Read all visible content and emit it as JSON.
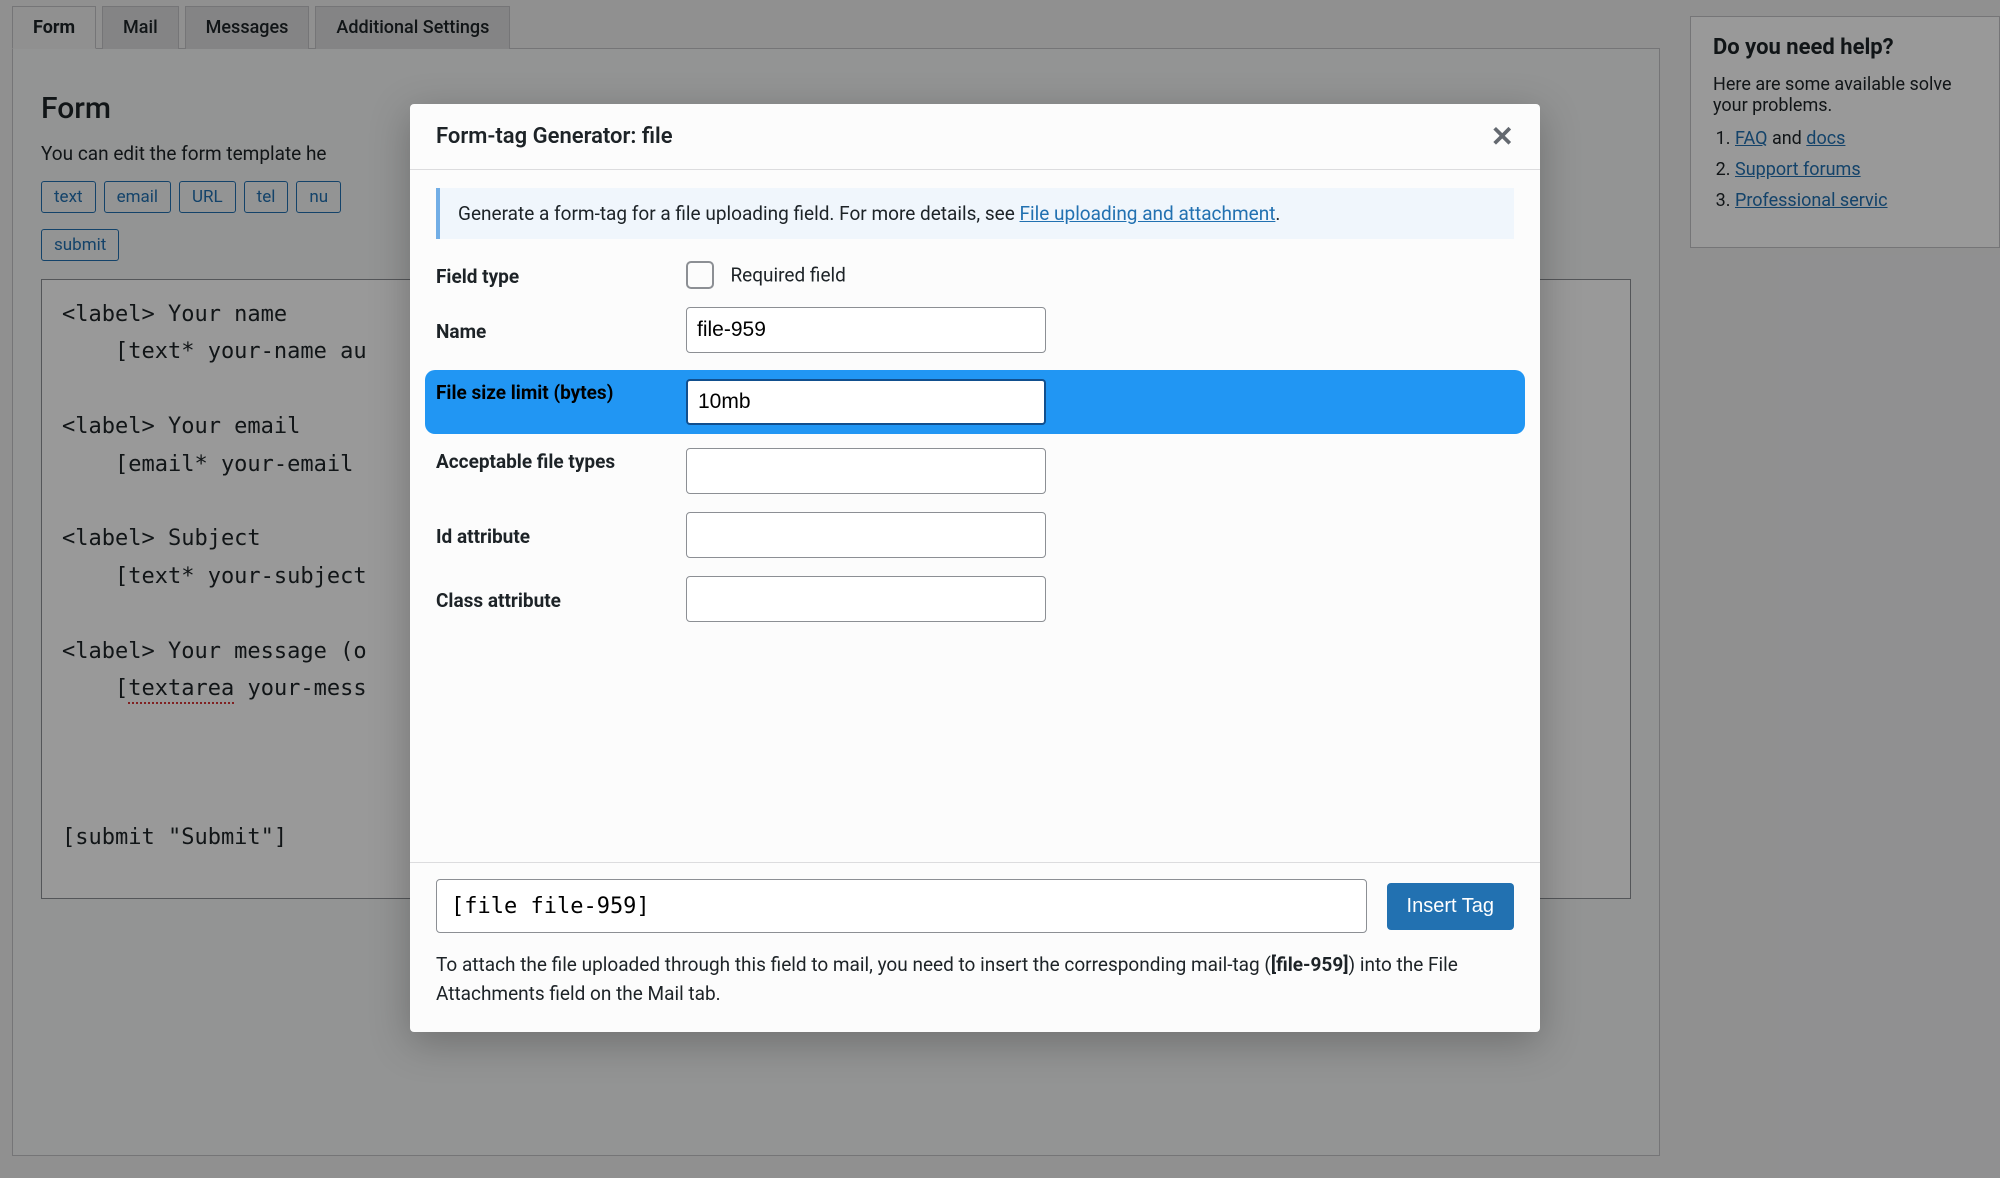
{
  "tabs": {
    "form": "Form",
    "mail": "Mail",
    "messages": "Messages",
    "additional": "Additional Settings"
  },
  "form_panel": {
    "heading": "Form",
    "intro": "You can edit the form template he",
    "tag_buttons": [
      "text",
      "email",
      "URL",
      "tel",
      "nu",
      "submit"
    ],
    "code_lines": {
      "l1_a": "<label> Your name",
      "l1_b": "    [text* your-name au",
      "l2_a": "<label> Your email",
      "l2_b": "    [email* your-email ",
      "l3_a": "<label> Subject",
      "l3_b": "    [text* your-subject",
      "l4_a": "<label> Your message (o",
      "l4_b_prefix": "    [",
      "l4_b_word": "textarea",
      "l4_b_suffix": " your-mess",
      "l5": "[submit \"Submit\"]"
    }
  },
  "sidebar": {
    "heading": "Do you need help?",
    "intro": "Here are some available solve your problems.",
    "links": {
      "faq": "FAQ",
      "and": " and ",
      "docs": "docs",
      "forums": "Support forums",
      "pro": "Professional servic"
    }
  },
  "modal": {
    "title": "Form-tag Generator: file",
    "info_prefix": "Generate a form-tag for a file uploading field. For more details, see ",
    "info_link": "File uploading and attachment",
    "info_suffix": ".",
    "labels": {
      "field_type": "Field type",
      "required": "Required field",
      "name": "Name",
      "file_size": "File size limit (bytes)",
      "file_types": "Acceptable file types",
      "id_attr": "Id attribute",
      "class_attr": "Class attribute"
    },
    "values": {
      "name": "file-959",
      "file_size": "10mb",
      "file_types": "",
      "id_attr": "",
      "class_attr": ""
    },
    "generated": "[file file-959]",
    "insert_btn": "Insert Tag",
    "footer_note_1": "To attach the file uploaded through this field to mail, you need to insert the corresponding mail-tag (",
    "footer_note_tag": "[file-959]",
    "footer_note_2": ") into the File Attachments field on the Mail tab."
  }
}
